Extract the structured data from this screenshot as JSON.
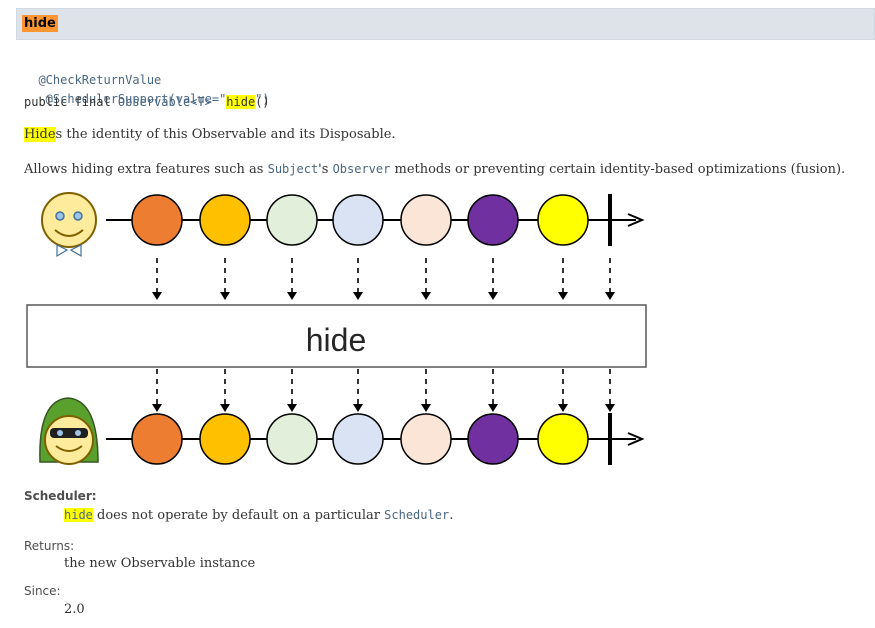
{
  "header": {
    "method_name": "hide"
  },
  "signature": {
    "annotation1": "@CheckReturnValue",
    "annotation2": " @SchedulerSupport(value=\"none\")",
    "modifiers": "public final ",
    "return_type": "Observable<T>",
    "method": "hide",
    "parens": "()"
  },
  "description": {
    "line1_highlight": "Hide",
    "line1_rest": "s the identity of this Observable and its Disposable.",
    "line2_pre": "Allows hiding extra features such as ",
    "line2_code1": "Subject",
    "line2_mid": "'s ",
    "line2_code2": "Observer",
    "line2_post": " methods or preventing certain identity-based optimizations (fusion)."
  },
  "diagram": {
    "operator_label": "hide",
    "marble_colors": [
      "#ed7d31",
      "#ffc000",
      "#e2efda",
      "#dae3f3",
      "#fbe5d6",
      "#7030a0",
      "#ffff00"
    ],
    "hood_color": "#5aa02c"
  },
  "scheduler": {
    "label": "Scheduler:",
    "code_highlight": "hide",
    "text_mid": " does not operate by default on a particular ",
    "code_link": "Scheduler",
    "text_end": "."
  },
  "returns": {
    "label": "Returns:",
    "text": "the new Observable instance"
  },
  "since": {
    "label": "Since:",
    "value": "2.0"
  }
}
